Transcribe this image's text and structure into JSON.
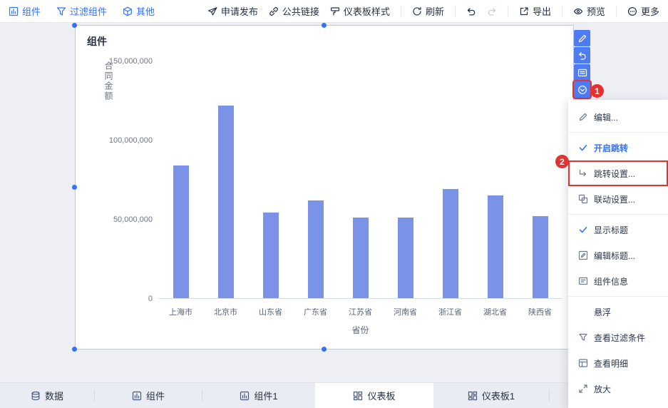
{
  "colors": {
    "accent": "#3370ff",
    "bar": "#7b93e6",
    "annotation_red": "#e23333"
  },
  "topbar": {
    "left_items": [
      {
        "label": "组件",
        "icon": "widget-icon"
      },
      {
        "label": "过滤组件",
        "icon": "filter-icon"
      },
      {
        "label": "其他",
        "icon": "other-cube-icon"
      }
    ],
    "right_items": [
      {
        "label": "申请发布",
        "icon": "send-icon"
      },
      {
        "label": "公共链接",
        "icon": "link-icon"
      },
      {
        "label": "仪表板样式",
        "icon": "style-icon"
      },
      {
        "label": "刷新",
        "icon": "refresh-icon"
      },
      {
        "label": "",
        "icon": "undo-icon"
      },
      {
        "label": "",
        "icon": "redo-icon"
      },
      {
        "label": "导出",
        "icon": "export-icon"
      },
      {
        "label": "预览",
        "icon": "preview-icon"
      },
      {
        "label": "更多",
        "icon": "more-icon"
      }
    ]
  },
  "component": {
    "title": "组件"
  },
  "chart_data": {
    "type": "bar",
    "title": "组件",
    "categories": [
      "上海市",
      "北京市",
      "山东省",
      "广东省",
      "江苏省",
      "河南省",
      "浙江省",
      "湖北省",
      "陕西省"
    ],
    "values": [
      84000000,
      122000000,
      54000000,
      62000000,
      51000000,
      51000000,
      69000000,
      65000000,
      52000000
    ],
    "xlabel": "省份",
    "ylabel": "合同金额",
    "ylim": [
      0,
      150000000
    ],
    "yticks": [
      0,
      50000000,
      100000000,
      150000000
    ],
    "ytick_labels": [
      "0",
      "50,000,000",
      "100,000,000",
      "150,000,000"
    ],
    "bar_color": "#7b93e6",
    "grid": false,
    "legend": null
  },
  "side_toolbar": {
    "buttons": [
      {
        "name": "edit"
      },
      {
        "name": "revert"
      },
      {
        "name": "card"
      },
      {
        "name": "more",
        "highlighted": true
      }
    ]
  },
  "context_menu": {
    "items": [
      {
        "label": "编辑..."
      },
      {
        "label": "开启跳转",
        "checked": true,
        "active": true
      },
      {
        "label": "跳转设置...",
        "highlighted": true
      },
      {
        "label": "联动设置..."
      },
      {
        "label": "显示标题",
        "checked": true
      },
      {
        "label": "编辑标题..."
      },
      {
        "label": "组件信息"
      },
      {
        "label": "悬浮"
      },
      {
        "label": "查看过滤条件"
      },
      {
        "label": "查看明细"
      },
      {
        "label": "放大"
      }
    ]
  },
  "bottom_tabs": [
    {
      "label": "数据",
      "icon": "database-icon"
    },
    {
      "label": "组件",
      "icon": "chart-icon"
    },
    {
      "label": "组件1",
      "icon": "chart-icon"
    },
    {
      "label": "仪表板",
      "icon": "dashboard-icon",
      "active": true
    },
    {
      "label": "仪表板1",
      "icon": "dashboard-icon"
    }
  ],
  "annotations": {
    "step1": "1",
    "step2": "2"
  }
}
